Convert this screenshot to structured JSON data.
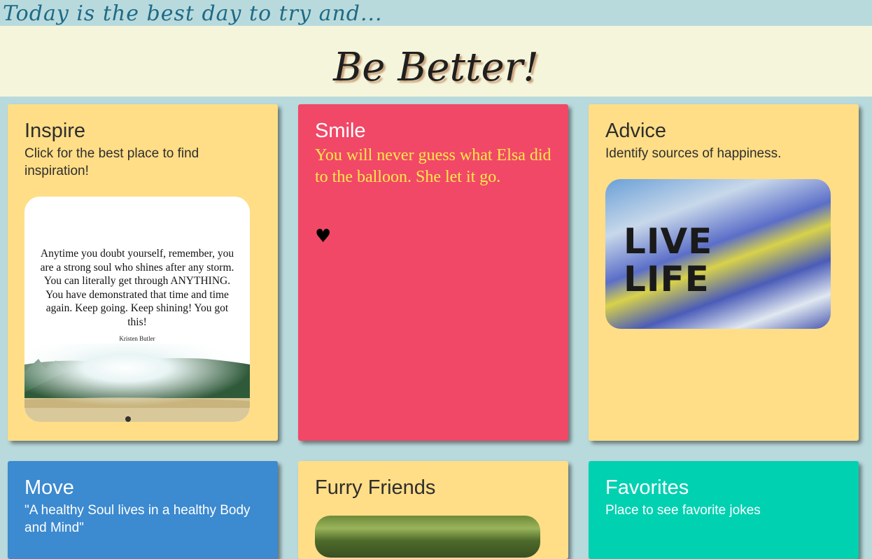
{
  "header": {
    "tagline": "Today is the best day to try and...",
    "headline": "Be Better!"
  },
  "cards": {
    "inspire": {
      "title": "Inspire",
      "text": "Click for the best place to find inspiration!",
      "quote": "Anytime you doubt yourself, remember, you are a strong soul who shines after any storm. You can literally get through ANYTHING. You have demonstrated that time and time again. Keep going. Keep shining! You got this!",
      "quote_author": "Kristen Butler"
    },
    "smile": {
      "title": "Smile",
      "joke": "You will never guess what Elsa did to the balloon. She let it go.",
      "heart_icon": "heart-icon"
    },
    "advice": {
      "title": "Advice",
      "text": "Identify sources of happiness.",
      "image_text": "LIVE LIFE"
    },
    "move": {
      "title": "Move",
      "text": "\"A healthy Soul lives in a healthy Body and Mind\""
    },
    "furry": {
      "title": "Furry Friends"
    },
    "favorites": {
      "title": "Favorites",
      "text": "Place to see favorite jokes"
    }
  },
  "colors": {
    "background": "#b9dadd",
    "banner": "#f5f5dc",
    "card_yellow": "#ffde87",
    "card_red": "#f14867",
    "card_blue": "#3c8ad0",
    "card_teal": "#00d1b1",
    "joke_text": "#ffe94a"
  }
}
